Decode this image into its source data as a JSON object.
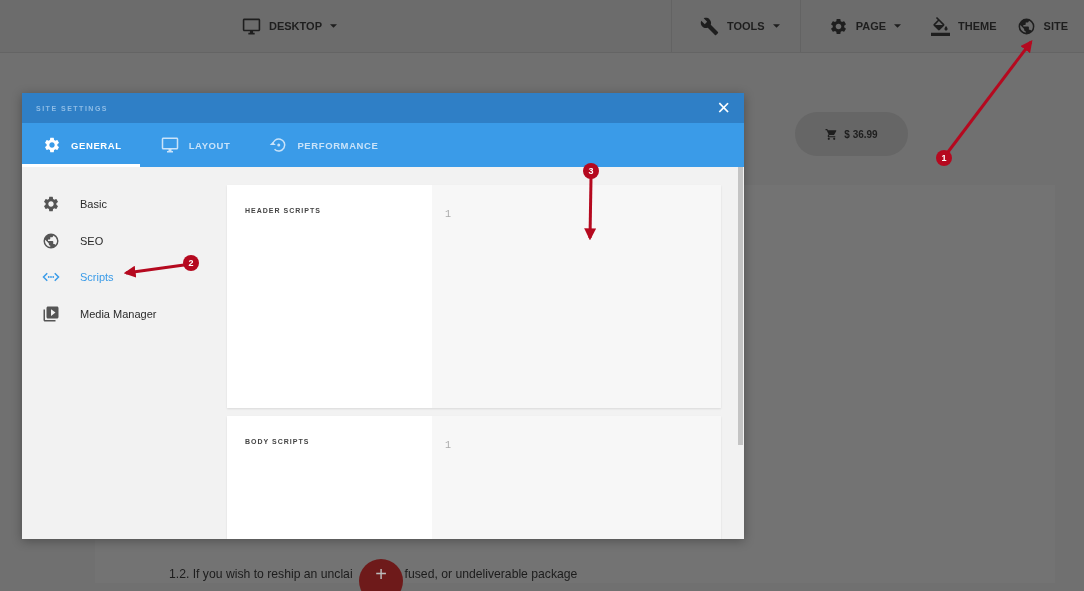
{
  "toolbar": {
    "items": [
      {
        "label": "DESKTOP",
        "dropdown": true
      },
      {
        "label": "TOOLS",
        "dropdown": true
      },
      {
        "label": "PAGE",
        "dropdown": true
      },
      {
        "label": "THEME",
        "dropdown": false
      },
      {
        "label": "SITE",
        "dropdown": false
      }
    ]
  },
  "cart": {
    "total": "$ 36.99"
  },
  "page_text": {
    "line_before": "1.2. If you wish to reship an unclai",
    "line_after": "fused, or undeliverable package"
  },
  "fab": {
    "label": "+"
  },
  "modal": {
    "title": "SITE SETTINGS",
    "close": "×",
    "tabs": [
      {
        "label": "GENERAL",
        "selected": true
      },
      {
        "label": "LAYOUT",
        "selected": false
      },
      {
        "label": "PERFORMANCE",
        "selected": false
      }
    ],
    "sidebar": [
      {
        "label": "Basic",
        "selected": false
      },
      {
        "label": "SEO",
        "selected": false
      },
      {
        "label": "Scripts",
        "selected": true
      },
      {
        "label": "Media Manager",
        "selected": false
      }
    ],
    "sections": [
      {
        "label": "HEADER SCRIPTS",
        "line_number": "1"
      },
      {
        "label": "BODY SCRIPTS",
        "line_number": "1"
      }
    ]
  },
  "annotations": [
    {
      "number": "1"
    },
    {
      "number": "2"
    },
    {
      "number": "3"
    }
  ]
}
